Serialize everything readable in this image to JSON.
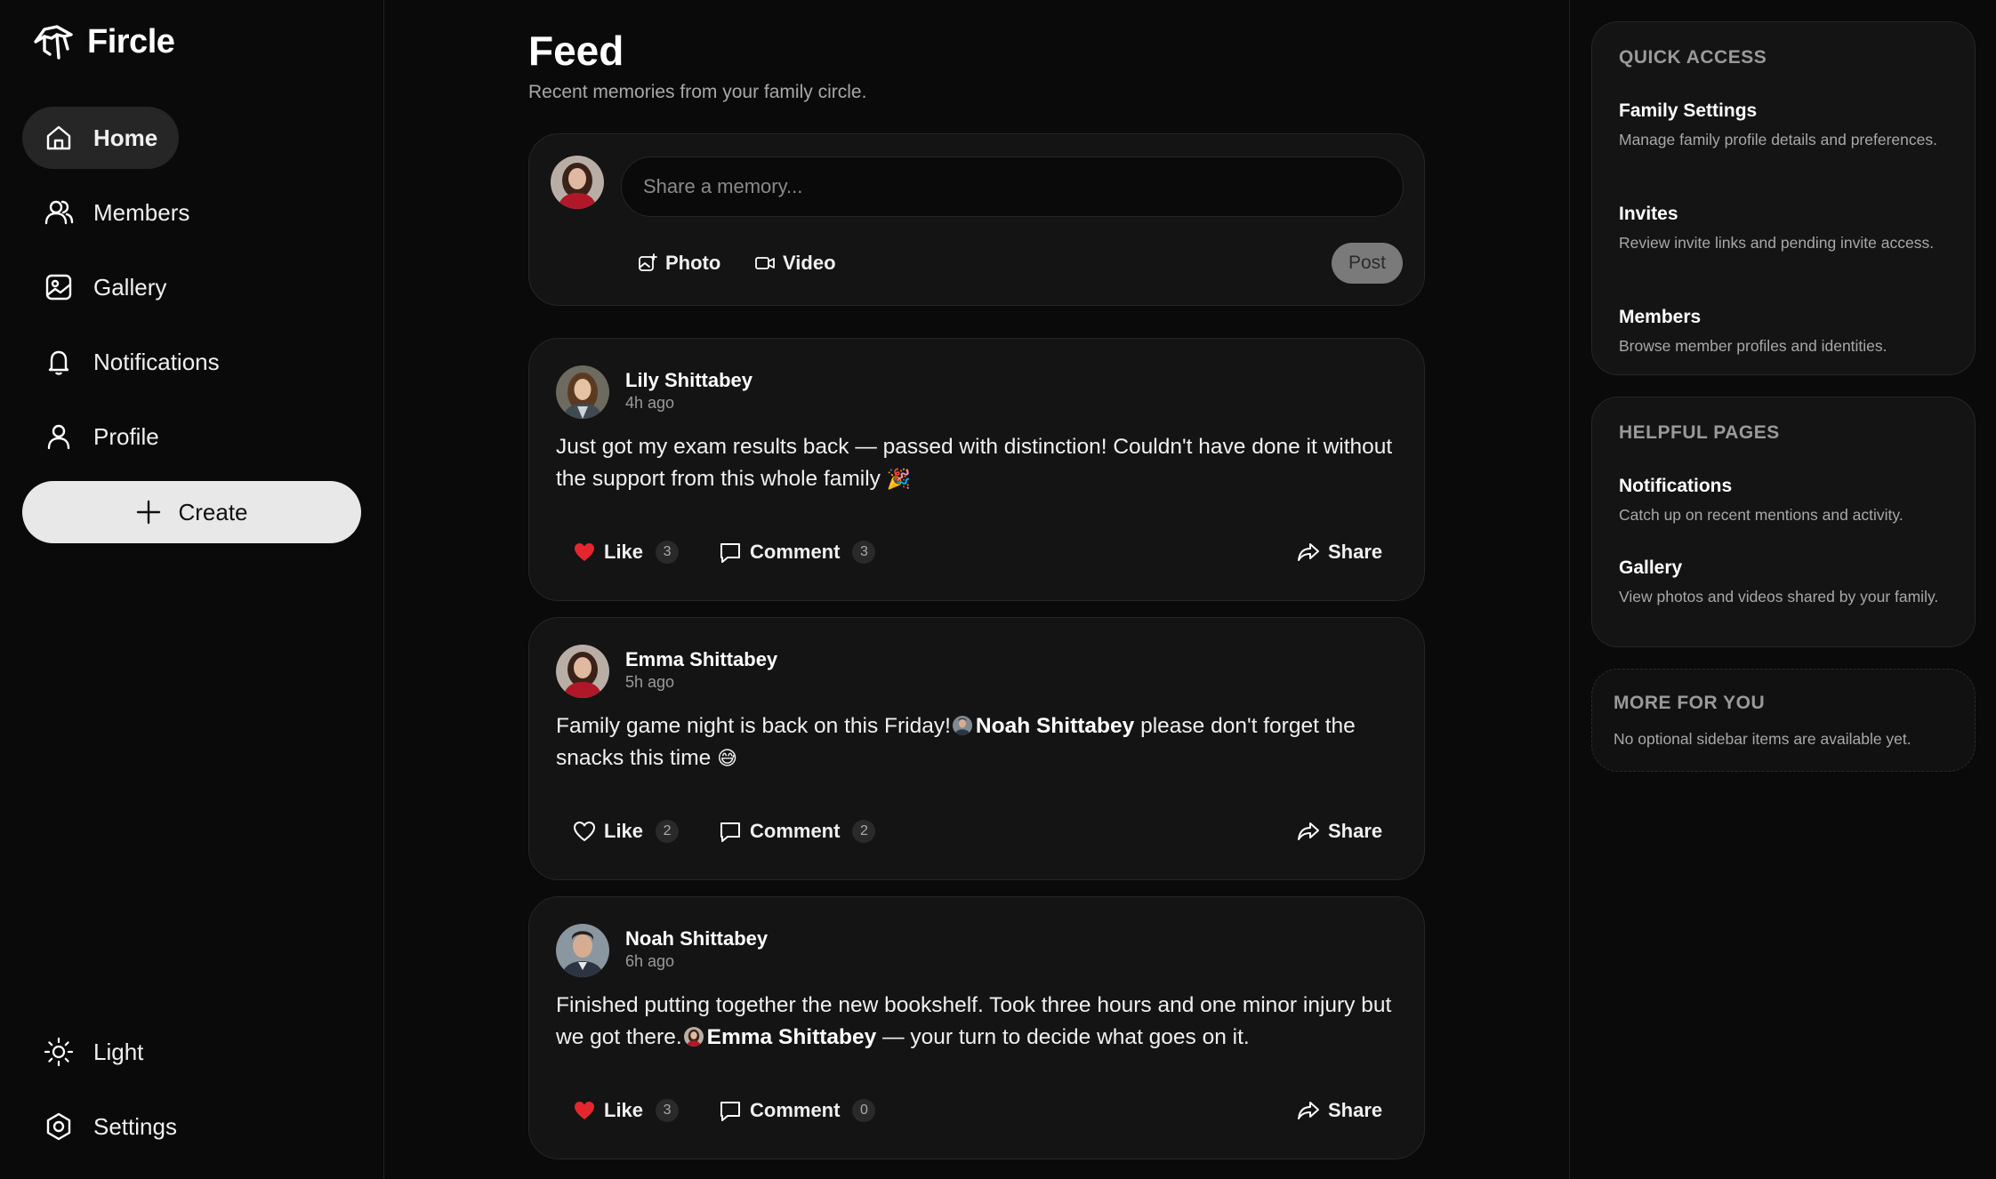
{
  "app": {
    "name": "Fircle"
  },
  "nav": {
    "items": [
      {
        "label": "Home",
        "icon": "home-icon",
        "active": true
      },
      {
        "label": "Members",
        "icon": "members-icon"
      },
      {
        "label": "Gallery",
        "icon": "gallery-icon"
      },
      {
        "label": "Notifications",
        "icon": "bell-icon"
      },
      {
        "label": "Profile",
        "icon": "user-icon"
      }
    ],
    "create_label": "Create",
    "theme_label": "Light",
    "settings_label": "Settings"
  },
  "feed": {
    "title": "Feed",
    "subtitle": "Recent memories from your family circle."
  },
  "composer": {
    "placeholder": "Share a memory...",
    "photo_label": "Photo",
    "video_label": "Video",
    "post_label": "Post"
  },
  "posts": [
    {
      "author": "Lily Shittabey",
      "time": "4h ago",
      "text_before": "Just got my exam results back — passed with distinction! Couldn't have done it without the support from this whole family",
      "emoji": "🎉",
      "liked": true,
      "like_label": "Like",
      "like_count": "3",
      "comment_label": "Comment",
      "comment_count": "3",
      "share_label": "Share"
    },
    {
      "author": "Emma Shittabey",
      "time": "5h ago",
      "text_before": "Family game night is back on this Friday!",
      "mention": "Noah Shittabey",
      "text_after": "please don't forget the snacks this time",
      "emoji": "😅",
      "liked": false,
      "like_label": "Like",
      "like_count": "2",
      "comment_label": "Comment",
      "comment_count": "2",
      "share_label": "Share"
    },
    {
      "author": "Noah Shittabey",
      "time": "6h ago",
      "text_before": "Finished putting together the new bookshelf. Took three hours and one minor injury but we got there.",
      "mention": "Emma Shittabey",
      "text_after": "— your turn to decide what goes on it.",
      "liked": true,
      "like_label": "Like",
      "like_count": "3",
      "comment_label": "Comment",
      "comment_count": "0",
      "share_label": "Share"
    }
  ],
  "quick_access": {
    "title": "QUICK ACCESS",
    "links": [
      {
        "title": "Family Settings",
        "desc": "Manage family profile details and preferences."
      },
      {
        "title": "Invites",
        "desc": "Review invite links and pending invite access."
      },
      {
        "title": "Members",
        "desc": "Browse member profiles and identities."
      }
    ]
  },
  "helpful_pages": {
    "title": "HELPFUL PAGES",
    "links": [
      {
        "title": "Notifications",
        "desc": "Catch up on recent mentions and activity."
      },
      {
        "title": "Gallery",
        "desc": "View photos and videos shared by your family."
      }
    ]
  },
  "more_for_you": {
    "title": "MORE FOR YOU",
    "desc": "No optional sidebar items are available yet."
  },
  "colors": {
    "like_red": "#e5262f",
    "background": "#0a0a0a",
    "card": "#141414"
  }
}
